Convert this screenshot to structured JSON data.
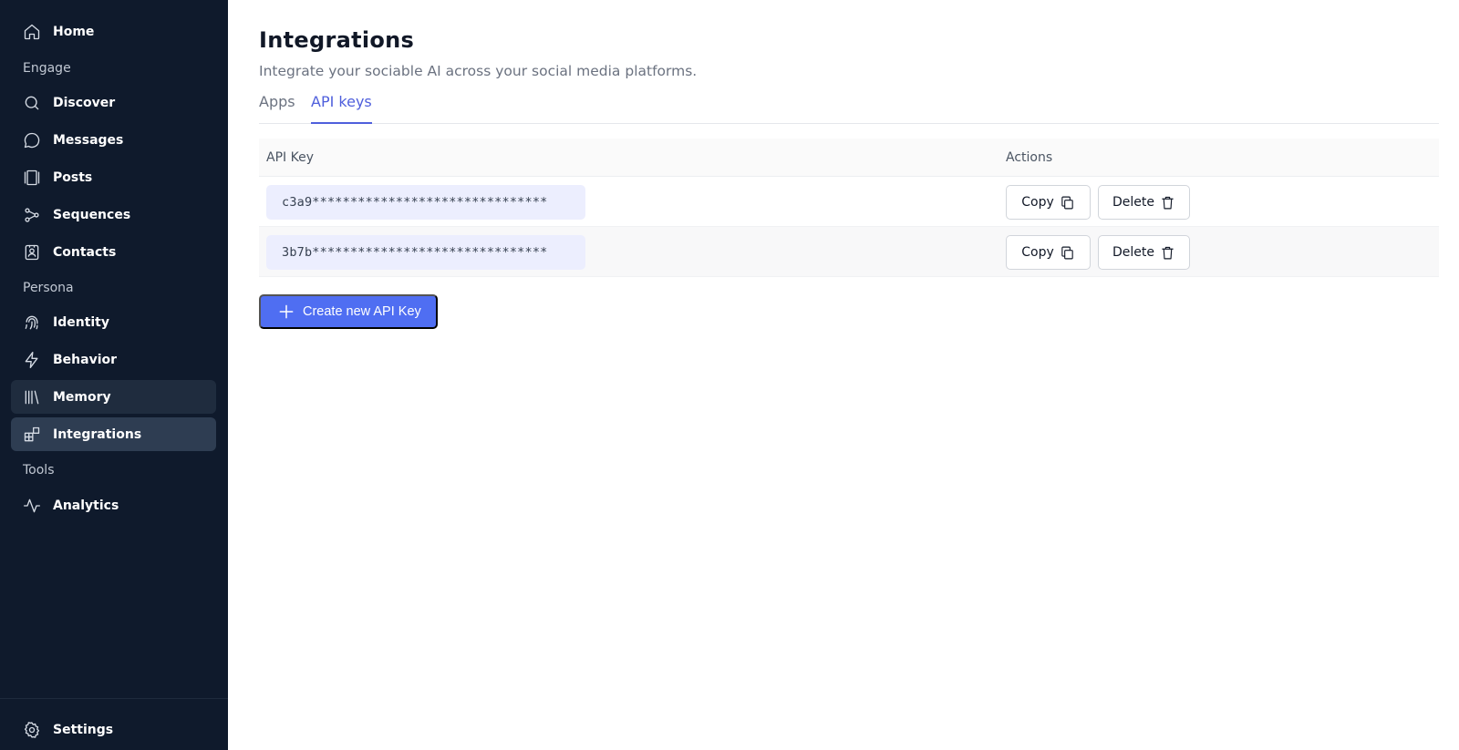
{
  "sidebar": {
    "home": "Home",
    "sections": {
      "engage": "Engage",
      "persona": "Persona",
      "tools": "Tools"
    },
    "items": {
      "discover": "Discover",
      "messages": "Messages",
      "posts": "Posts",
      "sequences": "Sequences",
      "contacts": "Contacts",
      "identity": "Identity",
      "behavior": "Behavior",
      "memory": "Memory",
      "integrations": "Integrations",
      "analytics": "Analytics"
    },
    "settings": "Settings",
    "active_item": "Integrations"
  },
  "page": {
    "title": "Integrations",
    "subtitle": "Integrate your sociable AI across your social media platforms."
  },
  "tabs": [
    {
      "label": "Apps",
      "active": false
    },
    {
      "label": "API keys",
      "active": true
    }
  ],
  "table": {
    "headers": {
      "key": "API Key",
      "actions": "Actions"
    },
    "rows": [
      {
        "key": "c3a9*******************************",
        "copy": "Copy",
        "delete": "Delete"
      },
      {
        "key": "3b7b*******************************",
        "copy": "Copy",
        "delete": "Delete"
      }
    ]
  },
  "create_button": "Create new API Key",
  "colors": {
    "sidebar_bg": "#0f1a2c",
    "accent": "#4f6ef2",
    "tab_active": "#4f5fdc",
    "key_chip_bg": "#eceefe"
  },
  "icons": {
    "home": "home-icon",
    "discover": "search-icon",
    "messages": "chat-bubble-icon",
    "posts": "posts-icon",
    "sequences": "sequence-icon",
    "contacts": "contact-card-icon",
    "identity": "fingerprint-icon",
    "behavior": "lightning-icon",
    "memory": "library-icon",
    "integrations": "grid-plus-icon",
    "analytics": "activity-icon",
    "settings": "gear-icon",
    "copy": "copy-icon",
    "delete": "trash-icon",
    "create": "plus-icon"
  }
}
